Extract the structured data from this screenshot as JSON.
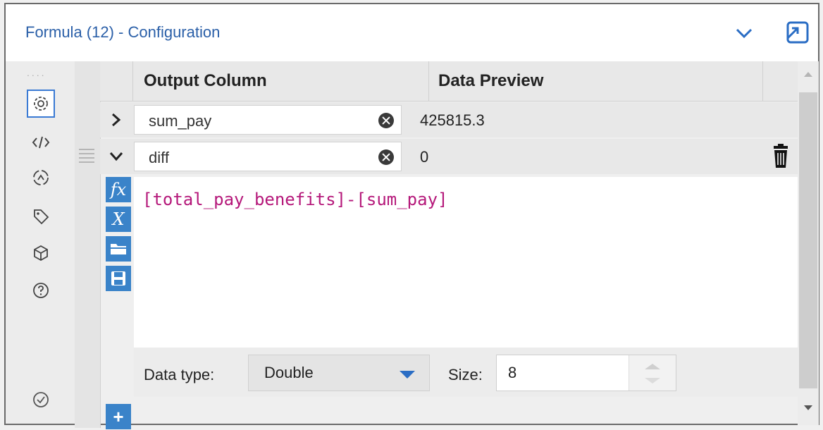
{
  "window": {
    "title": "Formula (12) - Configuration"
  },
  "table": {
    "headers": [
      "Output Column",
      "Data Preview"
    ],
    "rows": [
      {
        "name": "sum_pay",
        "preview": "425815.3",
        "expanded": false
      },
      {
        "name": "diff",
        "preview": "0",
        "expanded": true
      }
    ]
  },
  "editor": {
    "expression": "[total_pay_benefits]-[sum_pay]"
  },
  "tools": [
    {
      "icon": "fx-icon",
      "glyph": "fx"
    },
    {
      "icon": "variable-x-icon",
      "glyph": "X"
    },
    {
      "icon": "open-folder-icon",
      "glyph": ""
    },
    {
      "icon": "save-icon",
      "glyph": ""
    }
  ],
  "footer": {
    "data_type_label": "Data type:",
    "data_type_value": "Double",
    "size_label": "Size:",
    "size_value": "8"
  },
  "colors": {
    "accent": "#3a83c9",
    "title": "#2a5fa8",
    "formula": "#b5187a"
  }
}
